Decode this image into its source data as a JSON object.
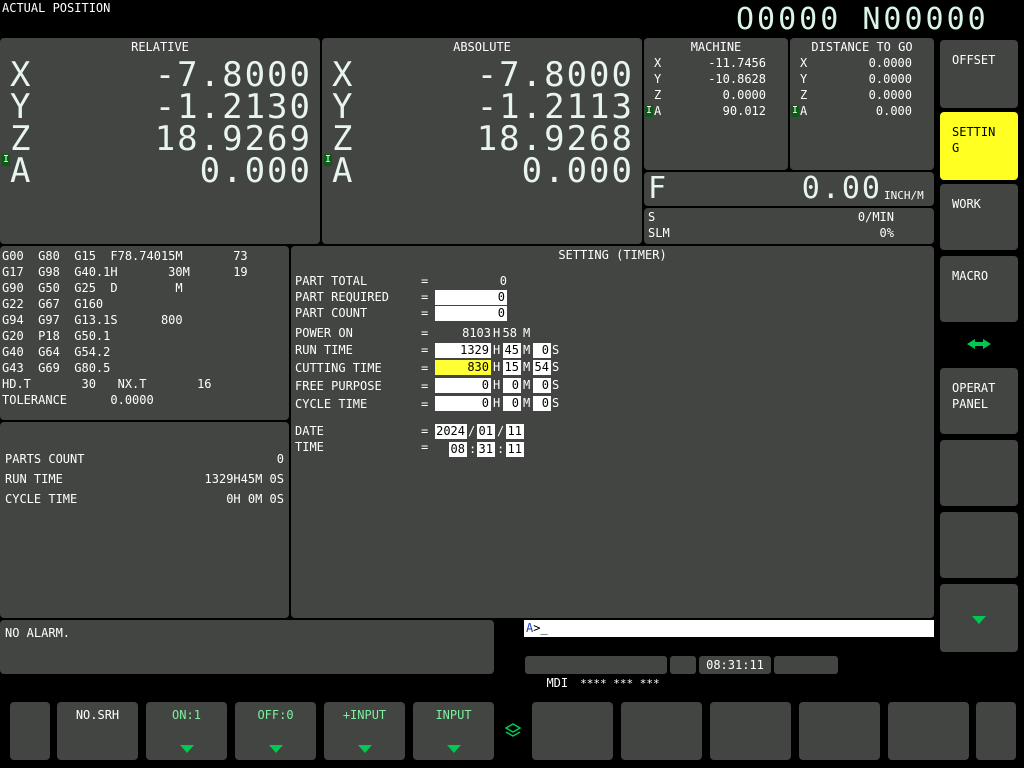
{
  "header": {
    "title": "ACTUAL POSITION",
    "program": "O0000 N00000"
  },
  "relative": {
    "title": "RELATIVE",
    "axes": [
      {
        "axis": "X",
        "value": "-7.8000"
      },
      {
        "axis": "Y",
        "value": "-1.2130"
      },
      {
        "axis": "Z",
        "value": "18.9269"
      },
      {
        "axis": "A",
        "value": "0.000"
      }
    ]
  },
  "absolute": {
    "title": "ABSOLUTE",
    "axes": [
      {
        "axis": "X",
        "value": "-7.8000"
      },
      {
        "axis": "Y",
        "value": "-1.2113"
      },
      {
        "axis": "Z",
        "value": "18.9268"
      },
      {
        "axis": "A",
        "value": "0.000"
      }
    ]
  },
  "machine": {
    "title": "MACHINE",
    "axes": [
      {
        "axis": "X",
        "value": "-11.7456"
      },
      {
        "axis": "Y",
        "value": "-10.8628"
      },
      {
        "axis": "Z",
        "value": "0.0000"
      },
      {
        "axis": "A",
        "value": "90.012"
      }
    ]
  },
  "distance": {
    "title": "DISTANCE TO GO",
    "axes": [
      {
        "axis": "X",
        "value": "0.0000"
      },
      {
        "axis": "Y",
        "value": "0.0000"
      },
      {
        "axis": "Z",
        "value": "0.0000"
      },
      {
        "axis": "A",
        "value": "0.000"
      }
    ]
  },
  "indicator": "I",
  "feed": {
    "label": "F",
    "value": "0.00",
    "unit": "INCH/M",
    "s_label": "S",
    "s_value": "0/MIN",
    "slm_label": "SLM",
    "slm_value": "0%"
  },
  "modal": {
    "lines": [
      "G00  G80  G15  F78.74015M       73",
      "G17  G98  G40.1H       30M      19",
      "G90  G50  G25  D        M",
      "G22  G67  G160",
      "G94  G97  G13.1S      800",
      "G20  P18  G50.1",
      "G40  G64  G54.2",
      "G43  G69  G80.5",
      "HD.T       30   NX.T       16",
      "TOLERANCE      0.0000"
    ]
  },
  "counts": {
    "parts_label": "PARTS COUNT",
    "parts_value": "0",
    "run_label": "RUN TIME",
    "run_value": "1329H45M 0S",
    "cycle_label": "CYCLE TIME",
    "cycle_value": "0H 0M 0S"
  },
  "setting": {
    "title": "SETTING (TIMER)",
    "eq": "=",
    "part_total_label": "PART TOTAL",
    "part_total_value": "0",
    "part_required_label": "PART REQUIRED",
    "part_required_value": "0",
    "part_count_label": "PART COUNT",
    "part_count_value": "0",
    "power_on_label": "POWER ON",
    "power_on_h": "8103",
    "power_on_m": "58",
    "run_time_label": "RUN TIME",
    "run_time_h": "1329",
    "run_time_m": "45",
    "run_time_s": "0",
    "cutting_time_label": "CUTTING TIME",
    "cutting_time_h": "830",
    "cutting_time_m": "15",
    "cutting_time_s": "54",
    "free_purpose_label": "FREE PURPOSE",
    "free_purpose_h": "0",
    "free_purpose_m": "0",
    "free_purpose_s": "0",
    "cycle_time_label": "CYCLE TIME",
    "cycle_time_h": "0",
    "cycle_time_m": "0",
    "cycle_time_s": "0",
    "unit_h": "H",
    "unit_m": "M",
    "unit_s": "S",
    "date_label": "DATE",
    "date_y": "2024",
    "date_m": "01",
    "date_d": "11",
    "date_sep": "/",
    "time_label": "TIME",
    "time_h": "08",
    "time_m": "31",
    "time_s": "11",
    "time_sep": ":"
  },
  "alarm": {
    "text": "NO ALARM."
  },
  "input": {
    "prompt": "A",
    "value": ">_"
  },
  "status": {
    "mode": "MDI",
    "state": "**** *** ***",
    "clock": "08:31:11"
  },
  "side_keys": [
    {
      "label": "OFFSET"
    },
    {
      "label": "SETTIN\nG"
    },
    {
      "label": "WORK"
    },
    {
      "label": "MACRO"
    },
    {
      "label": "OPERAT\nPANEL"
    }
  ],
  "soft_keys": [
    {
      "label": "NO.SRH"
    },
    {
      "label": "ON:1"
    },
    {
      "label": "OFF:0"
    },
    {
      "label": "+INPUT"
    },
    {
      "label": "INPUT"
    }
  ],
  "colors": {
    "panel": "#424542",
    "active": "#ffff22",
    "arrow": "#00c853",
    "indicator": "#0a5c13"
  }
}
